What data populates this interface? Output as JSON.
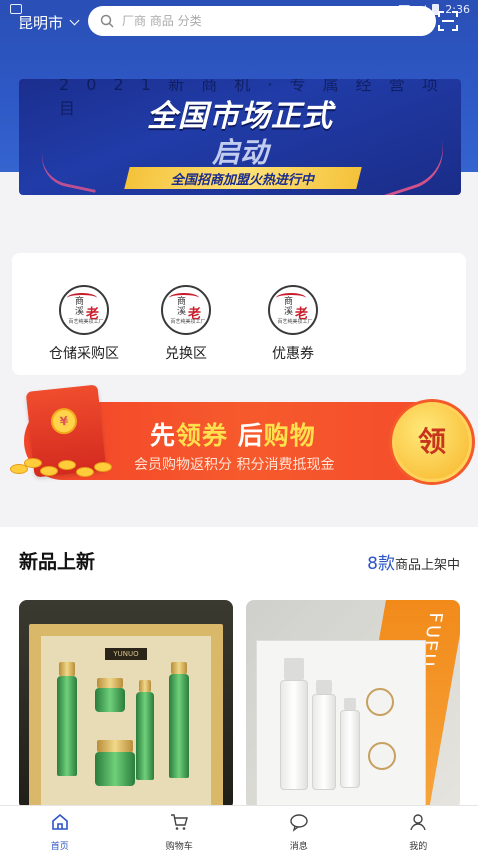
{
  "status_bar": {
    "time": "2:36"
  },
  "header": {
    "city": "昆明市",
    "search_placeholder": "厂商 商品 分类"
  },
  "banner": {
    "top_text": "2 0 2 1 新 商 机 · 专 属 经 营 项 目",
    "title_line1": "全国市场正式",
    "title_line2": "启动",
    "ribbon": "全国招商加盟火热进行中"
  },
  "categories": [
    {
      "label": "仓储采购区",
      "logo_char": "老",
      "logo_top": "商\n溪",
      "logo_sub": "百艺纯美妆工厂"
    },
    {
      "label": "兑换区",
      "logo_char": "老",
      "logo_top": "商\n溪",
      "logo_sub": "百艺纯美妆工厂"
    },
    {
      "label": "优惠券",
      "logo_char": "老",
      "logo_top": "商\n溪",
      "logo_sub": "百艺纯美妆工厂"
    }
  ],
  "promo": {
    "title_a": "先",
    "title_b": "领券",
    "title_c": "后",
    "title_d": "购物",
    "subtitle": "会员购物返积分  积分消费抵现金",
    "button": "领",
    "coin_symbol": "¥"
  },
  "new_section": {
    "title": "新品上新",
    "count": "8款",
    "count_suffix": "商品上架中"
  },
  "products": [
    {
      "name": "green-skincare-set",
      "label": "YUNUO"
    },
    {
      "name": "fueu-skincare-set",
      "brand": "FUEU"
    }
  ],
  "tabs": [
    {
      "label": "首页",
      "active": true
    },
    {
      "label": "购物车",
      "active": false
    },
    {
      "label": "消息",
      "active": false
    },
    {
      "label": "我的",
      "active": false
    }
  ],
  "colors": {
    "brand_blue": "#2d55c6",
    "promo_red": "#f3442a",
    "gold": "#ffe04d"
  }
}
